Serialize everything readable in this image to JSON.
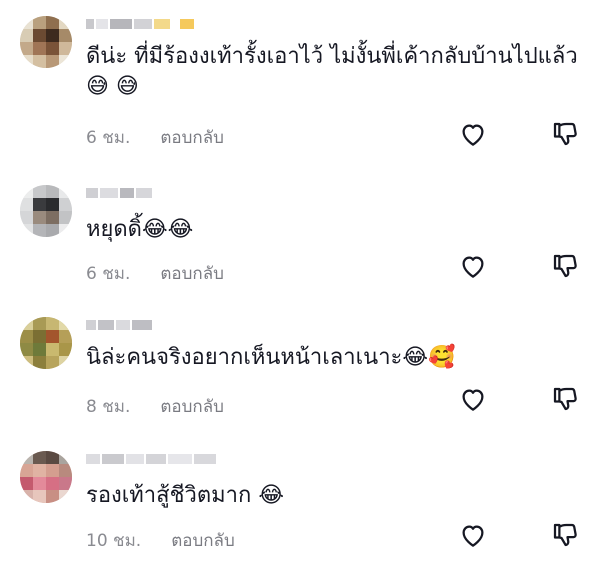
{
  "comments": [
    {
      "text": "ดีน่ะ ที่มีร้องงเท้ารั้งเอาไว้ ไม่งั้นพี่เค้ากลับบ้านไปแล้ว\n😅 😅",
      "time": "6 ชม.",
      "reply_label": "ตอบกลับ"
    },
    {
      "text": "หยุดดิ้😂😂",
      "time": "6 ชม.",
      "reply_label": "ตอบกลับ"
    },
    {
      "text": "นิล่ะคนจริงอยากเห็นหน้าเลาเนาะ😂🥰",
      "time": "8 ชม.",
      "reply_label": "ตอบกลับ"
    },
    {
      "text": "รองเท้าสู้ชีวิตมาก 😂",
      "time": "10 ชม.",
      "reply_label": "ตอบกลับ"
    }
  ],
  "icons": {
    "like": "heart-outline-icon",
    "dislike": "thumbs-down-outline-icon"
  },
  "colors": {
    "text": "#161823",
    "meta": "#8a8b91",
    "icon": "#161823"
  }
}
